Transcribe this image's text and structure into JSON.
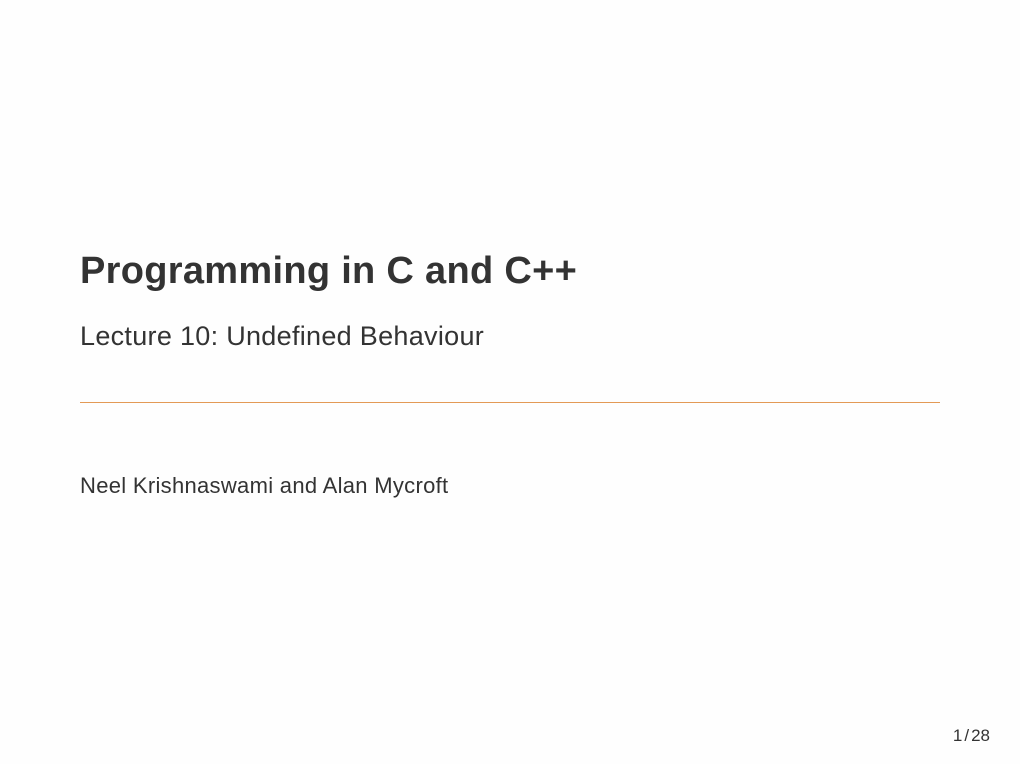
{
  "slide": {
    "title": "Programming in C and C++",
    "subtitle": "Lecture 10: Undefined Behaviour",
    "authors": "Neel Krishnaswami and Alan Mycroft"
  },
  "page": {
    "current": "1",
    "separator": "/",
    "total": "28"
  },
  "colors": {
    "rule": "#e39a56"
  }
}
